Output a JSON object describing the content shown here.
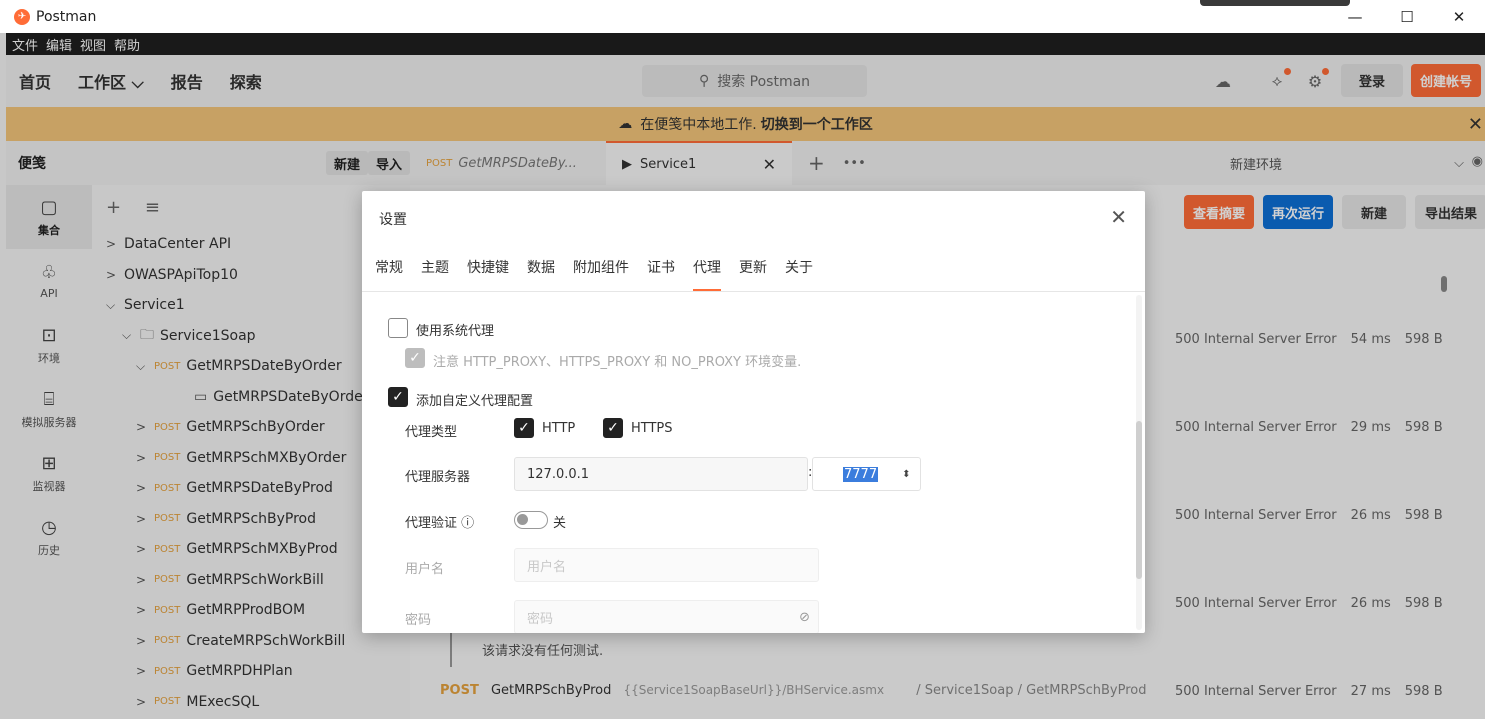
{
  "window": {
    "title": "Postman",
    "minimize": "—",
    "maximize": "☐",
    "close": "✕"
  },
  "menubar": [
    "文件",
    "编辑",
    "视图",
    "帮助"
  ],
  "header": {
    "nav": [
      "首页",
      "工作区 ⌵",
      "报告",
      "探索"
    ],
    "search_placeholder": "搜索 Postman",
    "login": "登录",
    "create_account": "创建帐号"
  },
  "banner": {
    "text": "在便笺中本地工作.",
    "link": "切换到一个工作区"
  },
  "sidebar": {
    "title": "便笺",
    "new_btn": "新建",
    "import_btn": "导入",
    "rail": [
      {
        "label": "集合",
        "icon": "collections-icon"
      },
      {
        "label": "API",
        "icon": "api-icon"
      },
      {
        "label": "环境",
        "icon": "environment-icon"
      },
      {
        "label": "模拟服务器",
        "icon": "mock-server-icon"
      },
      {
        "label": "监视器",
        "icon": "monitor-icon"
      },
      {
        "label": "历史",
        "icon": "history-icon"
      }
    ],
    "tree": [
      {
        "label": "DataCenter API",
        "method": "",
        "chev": ">"
      },
      {
        "label": "OWASPApiTop10",
        "method": "",
        "chev": ">"
      },
      {
        "label": "Service1",
        "method": "",
        "chev": "⌵"
      },
      {
        "label": "Service1Soap",
        "method": "",
        "chev": "⌵"
      },
      {
        "label": "GetMRPSDateByOrder",
        "method": "POST",
        "chev": "⌵"
      },
      {
        "label": "GetMRPSDateByOrder re...",
        "method": "",
        "chev": ""
      },
      {
        "label": "GetMRPSchByOrder",
        "method": "POST",
        "chev": ">"
      },
      {
        "label": "GetMRPSchMXByOrder",
        "method": "POST",
        "chev": ">"
      },
      {
        "label": "GetMRPSDateByProd",
        "method": "POST",
        "chev": ">"
      },
      {
        "label": "GetMRPSchByProd",
        "method": "POST",
        "chev": ">"
      },
      {
        "label": "GetMRPSchMXByProd",
        "method": "POST",
        "chev": ">"
      },
      {
        "label": "GetMRPSchWorkBill",
        "method": "POST",
        "chev": ">"
      },
      {
        "label": "GetMRPProdBOM",
        "method": "POST",
        "chev": ">"
      },
      {
        "label": "CreateMRPSchWorkBill",
        "method": "POST",
        "chev": ">"
      },
      {
        "label": "GetMRPDHPlan",
        "method": "POST",
        "chev": ">"
      },
      {
        "label": "MExecSQL",
        "method": "POST",
        "chev": ">"
      }
    ]
  },
  "tabs": {
    "tab1": {
      "method": "POST",
      "label": "GetMRPSDateBy..."
    },
    "tab2": {
      "label": "Service1"
    },
    "env": "新建环境"
  },
  "runner": {
    "summary": "查看摘要",
    "rerun": "再次运行",
    "new": "新建",
    "export": "导出结果",
    "results": [
      {
        "status": "500 Internal Server Error",
        "time": "54 ms",
        "size": "598 B"
      },
      {
        "status": "500 Internal Server Error",
        "time": "29 ms",
        "size": "598 B"
      },
      {
        "status": "500 Internal Server Error",
        "time": "26 ms",
        "size": "598 B"
      },
      {
        "status": "500 Internal Server Error",
        "time": "26 ms",
        "size": "598 B"
      },
      {
        "status": "500 Internal Server Error",
        "time": "27 ms",
        "size": "598 B"
      }
    ],
    "no_tests": "该请求没有任何测试.",
    "last_method": "POST",
    "last_name": "GetMRPSchByProd",
    "last_url": "{{Service1SoapBaseUrl}}/BHService.asmx",
    "last_path": "/ Service1Soap / GetMRPSchByProd"
  },
  "settings": {
    "title": "设置",
    "tabs": [
      "常规",
      "主题",
      "快捷键",
      "数据",
      "附加组件",
      "证书",
      "代理",
      "更新",
      "关于"
    ],
    "active_tab": "代理",
    "use_system_proxy": "使用系统代理",
    "env_note": "注意 HTTP_PROXY、HTTPS_PROXY 和 NO_PROXY 环境变量.",
    "add_custom_proxy": "添加自定义代理配置",
    "proxy_type_label": "代理类型",
    "http": "HTTP",
    "https": "HTTPS",
    "proxy_server_label": "代理服务器",
    "proxy_host": "127.0.0.1",
    "proxy_port": "7777",
    "proxy_auth_label": "代理验证 ⓘ",
    "proxy_auth_state": "关",
    "username_label": "用户名",
    "username_placeholder": "用户名",
    "password_label": "密码",
    "password_placeholder": "密码"
  }
}
